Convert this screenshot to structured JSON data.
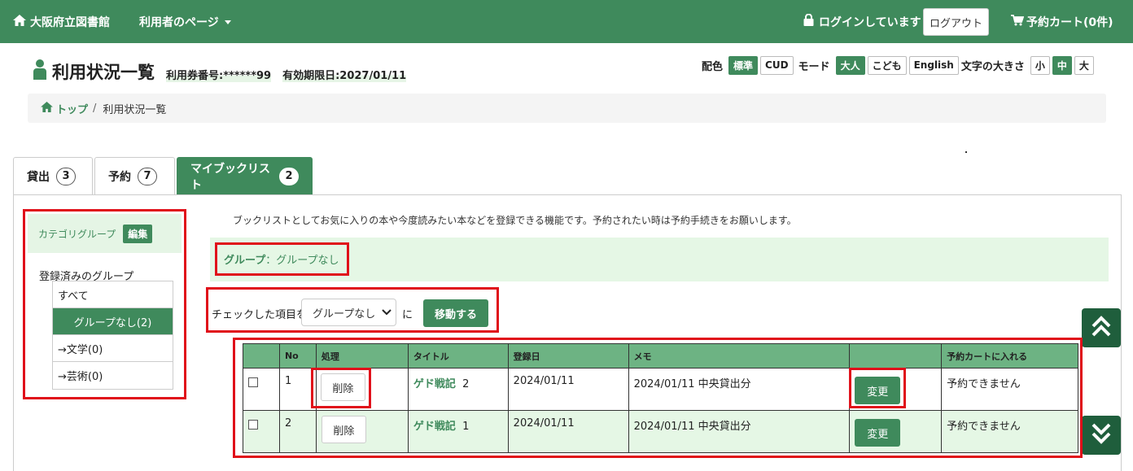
{
  "nav": {
    "brand": "大阪府立図書館",
    "user_menu": "利用者のページ",
    "login_status": "ログインしています",
    "logout": "ログアウト",
    "cart": "予約カート(0件)"
  },
  "header": {
    "title": "利用状況一覧",
    "card_number": "利用券番号:******99",
    "expiry": "有効期限日:2027/01/11"
  },
  "settings": {
    "color_label": "配色",
    "color_options": [
      "標準",
      "CUD"
    ],
    "mode_label": "モード",
    "mode_options": [
      "大人",
      "こども",
      "English"
    ],
    "size_label": "文字の大きさ",
    "size_options": [
      "小",
      "中",
      "大"
    ]
  },
  "breadcrumb": {
    "home": "トップ",
    "separator": "/",
    "current": "利用状況一覧"
  },
  "tabs": [
    {
      "label": "貸出",
      "count": "3"
    },
    {
      "label": "予約",
      "count": "7"
    },
    {
      "label": "マイブックリスト",
      "count": "2"
    }
  ],
  "sidebar": {
    "heading": "カテゴリグループ",
    "edit": "編集",
    "subheading": "登録済みのグループ",
    "items": [
      "すべて",
      "グループなし(2)",
      "→文学(0)",
      "→芸術(0)"
    ]
  },
  "description": "ブックリストとしてお気に入りの本や今度読みたい本などを登録できる機能です。予約されたい時は予約手続きをお願いします。",
  "group": {
    "label": "グループ",
    "value": "：グループなし"
  },
  "move": {
    "label": "チェックした項目を",
    "selected": "グループなし",
    "ni": "に",
    "button": "移動する"
  },
  "table": {
    "headers": [
      "",
      "No",
      "処理",
      "タイトル",
      "登録日",
      "メモ",
      "",
      "予約カートに入れる"
    ],
    "rows": [
      {
        "no": "1",
        "action": "削除",
        "title": "ゲド戦記",
        "volume": "2",
        "date": "2024/01/11",
        "memo": "2024/01/11 中央貸出分",
        "change": "変更",
        "cart": "予約できません"
      },
      {
        "no": "2",
        "action": "削除",
        "title": "ゲド戦記",
        "volume": "1",
        "date": "2024/01/11",
        "memo": "2024/01/11 中央貸出分",
        "change": "変更",
        "cart": "予約できません"
      }
    ]
  },
  "colors": {
    "primary": "#3f8a5c",
    "dark": "#1f5e3c",
    "light": "#e5f7e5",
    "highlight": "#e0101a"
  }
}
